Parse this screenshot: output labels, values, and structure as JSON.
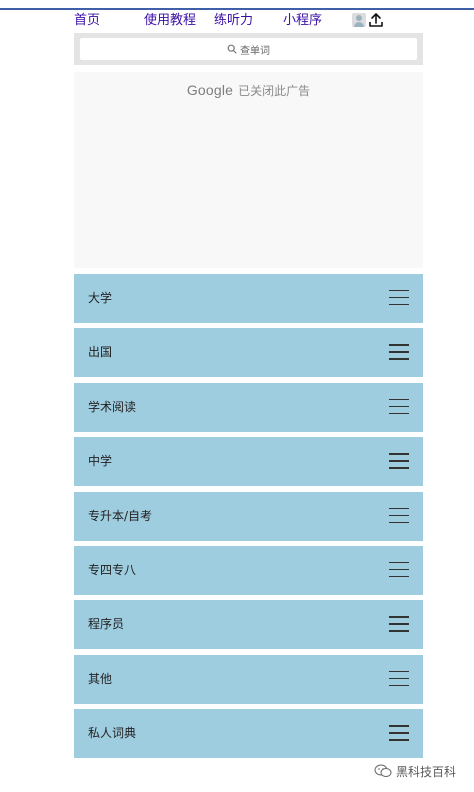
{
  "nav": {
    "links": [
      {
        "label": "首页"
      },
      {
        "label": "使用教程"
      },
      {
        "label": "练听力"
      },
      {
        "label": "小程序"
      }
    ],
    "icons": [
      "avatar-icon",
      "upload-icon"
    ]
  },
  "search": {
    "placeholder": "查单词",
    "icon": "search-icon"
  },
  "ad": {
    "brand": "Google",
    "status": "已关闭此广告"
  },
  "categories": [
    {
      "label": "大学"
    },
    {
      "label": "出国"
    },
    {
      "label": "学术阅读"
    },
    {
      "label": "中学"
    },
    {
      "label": "专升本/自考"
    },
    {
      "label": "专四专八"
    },
    {
      "label": "程序员"
    },
    {
      "label": "其他"
    },
    {
      "label": "私人词典"
    }
  ],
  "category_icon": "hamburger-menu-icon",
  "watermark": {
    "text": "黑科技百科",
    "icon": "wechat-icon"
  },
  "colors": {
    "nav_link": "#3a0ea6",
    "category_bg": "#9fcde0",
    "top_rule": "#3f5fa8"
  }
}
